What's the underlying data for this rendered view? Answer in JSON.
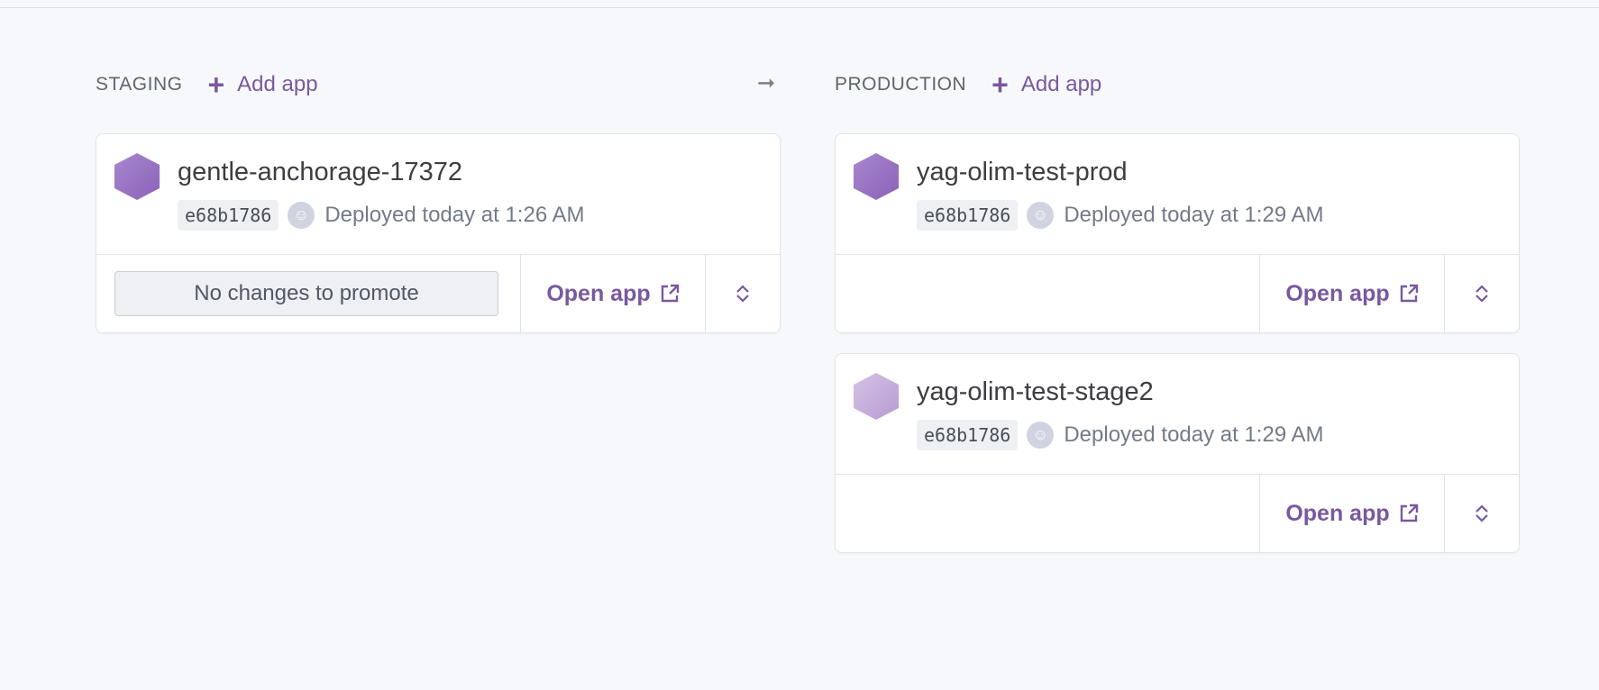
{
  "columns": {
    "staging": {
      "title": "STAGING",
      "add_label": "Add app",
      "apps": [
        {
          "name": "gentle-anchorage-17372",
          "commit": "e68b1786",
          "deployed": "Deployed today at 1:26 AM",
          "promote_label": "No changes to promote",
          "open_label": "Open app",
          "hex_color": "#9a75c4"
        }
      ]
    },
    "production": {
      "title": "PRODUCTION",
      "add_label": "Add app",
      "apps": [
        {
          "name": "yag-olim-test-prod",
          "commit": "e68b1786",
          "deployed": "Deployed today at 1:29 AM",
          "open_label": "Open app",
          "hex_color": "#9a75c4"
        },
        {
          "name": "yag-olim-test-stage2",
          "commit": "e68b1786",
          "deployed": "Deployed today at 1:29 AM",
          "open_label": "Open app",
          "hex_color": "#c9b5dc"
        }
      ]
    }
  },
  "icons": {
    "plus": "plus-icon",
    "arrow": "arrow-right-icon",
    "external": "external-link-icon",
    "chevron": "chevron-up-down-icon",
    "app": "hexagon-app-icon",
    "avatar": "user-avatar-icon"
  },
  "colors": {
    "accent": "#79589f",
    "background": "#f7f8fb"
  }
}
